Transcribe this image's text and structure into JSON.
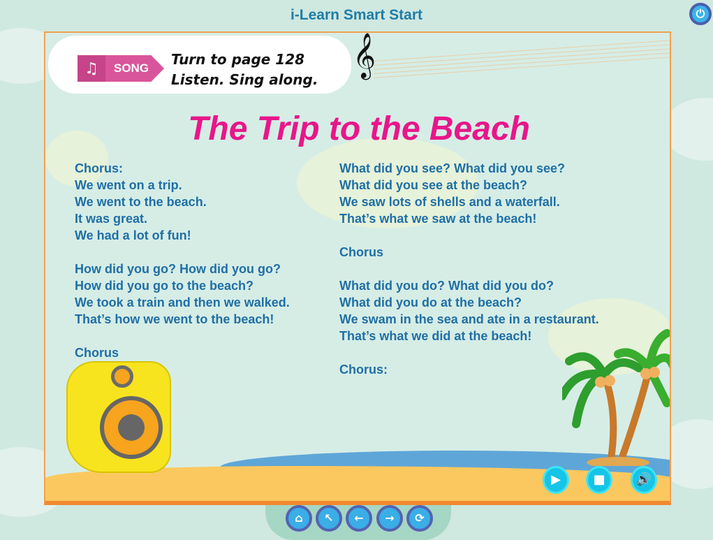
{
  "app": {
    "title": "i-Learn Smart Start"
  },
  "header": {
    "badge_label": "SONG",
    "instruction_line1": "Turn to page 128",
    "instruction_line2": "Listen. Sing along."
  },
  "song": {
    "title": "The Trip to the Beach",
    "left_column": [
      [
        "Chorus:",
        "We went on a trip.",
        "We went to the beach.",
        "It was great.",
        "We had a lot of fun!"
      ],
      [
        "How did you go? How did you go?",
        "How did you go to the beach?",
        "We took a train and then we walked.",
        "That’s how we went to the beach!"
      ],
      [
        "Chorus"
      ]
    ],
    "right_column": [
      [
        "What did you see? What did you see?",
        "What did you see at the beach?",
        "We saw lots of shells and a waterfall.",
        "That’s what we saw at the beach!"
      ],
      [
        "Chorus"
      ],
      [
        "What did you do? What did you do?",
        "What did you do at the beach?",
        "We swam in the sea and ate in a restaurant.",
        "That’s what we did at the beach!"
      ],
      [
        "Chorus:"
      ]
    ]
  },
  "colors": {
    "title": "#e8168a",
    "lyrics": "#1f6fa5",
    "frame": "#f0a050",
    "button": "#16c4e8"
  }
}
